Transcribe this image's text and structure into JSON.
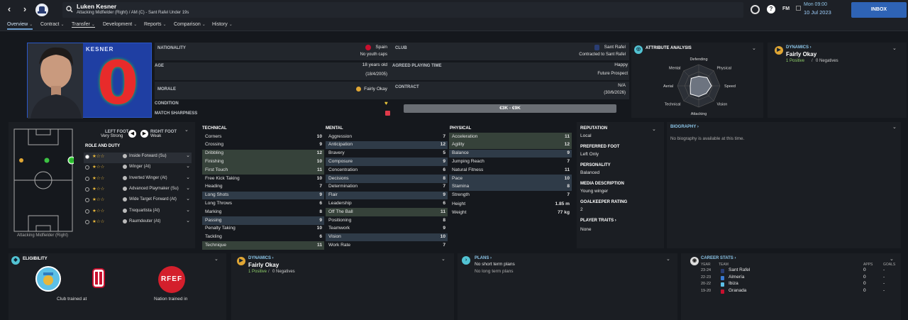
{
  "header": {
    "player_name": "Luken Kesner",
    "player_subtitle": "Attacking Midfielder (Right) / AM (C) - Sant Rafel Under 19s",
    "date_line1": "Mon 09:00",
    "date_line2": "10 Jul 2023",
    "fm_label": "FM",
    "inbox_label": "INBOX"
  },
  "nav": {
    "tabs": [
      {
        "label": "Overview"
      },
      {
        "label": "Contract"
      },
      {
        "label": "Transfer"
      },
      {
        "label": "Development"
      },
      {
        "label": "Reports"
      },
      {
        "label": "Comparison"
      },
      {
        "label": "History"
      }
    ]
  },
  "shirt": {
    "name": "KESNER",
    "number": "0"
  },
  "info": {
    "nationality_label": "NATIONALITY",
    "nationality": "Spain",
    "youth_caps": "No youth caps",
    "age_label": "AGE",
    "age": "18 years old",
    "dob": "(18/4/2005)",
    "morale_label": "MORALE",
    "morale": "Fairly Okay",
    "condition_label": "CONDITION",
    "sharpness_label": "MATCH SHARPNESS",
    "club_label": "CLUB",
    "club": "Sant Rafel",
    "contract_type": "Contracted to Sant Rafel",
    "playing_time_label": "AGREED PLAYING TIME",
    "playing_time_status": "Happy",
    "playing_time": "Future Prospect",
    "contract_label": "CONTRACT",
    "contract": "N/A",
    "contract_end": "(30/6/2026)",
    "value_range": "€3K - €9K"
  },
  "attribute_analysis": {
    "title": "ATTRIBUTE ANALYSIS",
    "labels": [
      "Defending",
      "Physical",
      "Speed",
      "Vision",
      "Attacking",
      "Technical",
      "Aerial",
      "Mental"
    ],
    "values": [
      0.45,
      0.55,
      0.6,
      0.5,
      0.5,
      0.55,
      0.4,
      0.5
    ]
  },
  "dynamics_top": {
    "title": "DYNAMICS",
    "status": "Fairly Okay",
    "positive": "1 Positive",
    "negatives": "0 Negatives"
  },
  "pitch": {
    "left_foot_label": "LEFT FOOT",
    "left_foot": "Very Strong",
    "right_foot_label": "RIGHT FOOT",
    "right_foot": "Weak",
    "position_label": "Attacking Midfielder (Right)"
  },
  "roles": {
    "title": "ROLE AND DUTY",
    "items": [
      {
        "stars": "★☆☆",
        "label": "Inside Forward (Su)",
        "rating": 1
      },
      {
        "stars": "★☆☆",
        "label": "Winger (At)",
        "rating": 0.75
      },
      {
        "stars": "★☆☆",
        "label": "Inverted Winger (At)",
        "rating": 0.75
      },
      {
        "stars": "★☆☆",
        "label": "Advanced Playmaker (Su)",
        "rating": 0.75
      },
      {
        "stars": "★☆☆",
        "label": "Wide Target Forward (At)",
        "rating": 0.5
      },
      {
        "stars": "★☆☆",
        "label": "Trequartista (At)",
        "rating": 0.5
      },
      {
        "stars": "★☆☆",
        "label": "Raumdeuter (At)",
        "rating": 0.5
      }
    ]
  },
  "technical": {
    "title": "TECHNICAL",
    "rows": [
      {
        "name": "Corners",
        "value": "10",
        "hl": ""
      },
      {
        "name": "Crossing",
        "value": "9",
        "hl": ""
      },
      {
        "name": "Dribbling",
        "value": "12",
        "hl": "g"
      },
      {
        "name": "Finishing",
        "value": "10",
        "hl": "g"
      },
      {
        "name": "First Touch",
        "value": "11",
        "hl": "g"
      },
      {
        "name": "Free Kick Taking",
        "value": "10",
        "hl": ""
      },
      {
        "name": "Heading",
        "value": "7",
        "hl": ""
      },
      {
        "name": "Long Shots",
        "value": "9",
        "hl": "b"
      },
      {
        "name": "Long Throws",
        "value": "6",
        "hl": ""
      },
      {
        "name": "Marking",
        "value": "8",
        "hl": ""
      },
      {
        "name": "Passing",
        "value": "9",
        "hl": "b"
      },
      {
        "name": "Penalty Taking",
        "value": "10",
        "hl": ""
      },
      {
        "name": "Tackling",
        "value": "6",
        "hl": ""
      },
      {
        "name": "Technique",
        "value": "11",
        "hl": "g"
      }
    ]
  },
  "mental": {
    "title": "MENTAL",
    "rows": [
      {
        "name": "Aggression",
        "value": "7",
        "hl": ""
      },
      {
        "name": "Anticipation",
        "value": "12",
        "hl": "b"
      },
      {
        "name": "Bravery",
        "value": "5",
        "hl": ""
      },
      {
        "name": "Composure",
        "value": "9",
        "hl": "b"
      },
      {
        "name": "Concentration",
        "value": "6",
        "hl": ""
      },
      {
        "name": "Decisions",
        "value": "8",
        "hl": "b"
      },
      {
        "name": "Determination",
        "value": "7",
        "hl": ""
      },
      {
        "name": "Flair",
        "value": "9",
        "hl": "b"
      },
      {
        "name": "Leadership",
        "value": "6",
        "hl": ""
      },
      {
        "name": "Off The Ball",
        "value": "11",
        "hl": "g"
      },
      {
        "name": "Positioning",
        "value": "8",
        "hl": ""
      },
      {
        "name": "Teamwork",
        "value": "9",
        "hl": ""
      },
      {
        "name": "Vision",
        "value": "10",
        "hl": "b"
      },
      {
        "name": "Work Rate",
        "value": "7",
        "hl": ""
      }
    ]
  },
  "physical": {
    "title": "PHYSICAL",
    "rows": [
      {
        "name": "Acceleration",
        "value": "11",
        "hl": "g"
      },
      {
        "name": "Agility",
        "value": "12",
        "hl": "g"
      },
      {
        "name": "Balance",
        "value": "9",
        "hl": "b"
      },
      {
        "name": "Jumping Reach",
        "value": "7",
        "hl": ""
      },
      {
        "name": "Natural Fitness",
        "value": "11",
        "hl": ""
      },
      {
        "name": "Pace",
        "value": "10",
        "hl": "b"
      },
      {
        "name": "Stamina",
        "value": "8",
        "hl": "b"
      },
      {
        "name": "Strength",
        "value": "7",
        "hl": ""
      }
    ],
    "height_label": "Height",
    "height": "1.85 m",
    "weight_label": "Weight",
    "weight": "77 kg"
  },
  "profile": {
    "reputation_label": "REPUTATION",
    "reputation": "Local",
    "pref_foot_label": "PREFERRED FOOT",
    "pref_foot": "Left Only",
    "personality_label": "PERSONALITY",
    "personality": "Balanced",
    "media_label": "MEDIA DESCRIPTION",
    "media": "Young winger",
    "gk_label": "GOALKEEPER RATING",
    "gk": "2",
    "traits_label": "PLAYER TRAITS",
    "traits": "None"
  },
  "biography": {
    "title": "BIOGRAPHY",
    "text": "No biography is available at this time."
  },
  "eligibility": {
    "title": "ELIGIBILITY",
    "club_trained": "Club trained at",
    "nation_trained": "Nation trained in",
    "rfef": "RFEF"
  },
  "dynamics_bottom": {
    "title": "DYNAMICS",
    "status": "Fairly Okay",
    "positive": "1 Positive",
    "negatives": "0 Negatives"
  },
  "plans": {
    "title": "PLANS",
    "short": "No short term plans",
    "long": "No long term plans"
  },
  "career": {
    "title": "CAREER STATS",
    "col_year": "YEAR",
    "col_team": "TEAM",
    "col_apps": "APPS",
    "col_goals": "GOALS",
    "rows": [
      {
        "year": "23-24",
        "team": "Sant Rafel",
        "apps": "0",
        "goals": "-"
      },
      {
        "year": "22-23",
        "team": "Almería",
        "apps": "0",
        "goals": "-"
      },
      {
        "year": "20-22",
        "team": "Ibiza",
        "apps": "0",
        "goals": "-"
      },
      {
        "year": "19-20",
        "team": "Granada",
        "apps": "0",
        "goals": "-"
      }
    ]
  },
  "colors": {
    "accent": "#3ab7d0",
    "green": "#9fd86b",
    "highlight_green": "#36423a",
    "highlight_blue": "#2f3b48",
    "inbox": "#2e63b5"
  }
}
